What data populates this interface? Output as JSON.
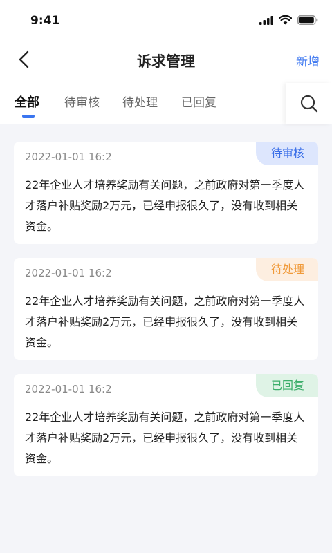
{
  "status_bar": {
    "time": "9:41"
  },
  "nav": {
    "title": "诉求管理",
    "add_label": "新增"
  },
  "tabs": [
    {
      "label": "全部",
      "active": true
    },
    {
      "label": "待审核",
      "active": false
    },
    {
      "label": "待处理",
      "active": false
    },
    {
      "label": "已回复",
      "active": false
    }
  ],
  "colors": {
    "accent": "#3a75f0",
    "pending_review": "#3a6fe8",
    "pending_process": "#f09a3a",
    "replied": "#3cae6a"
  },
  "cards": [
    {
      "time": "2022-01-01 16:2",
      "status": "待审核",
      "content": "22年企业人才培养奖励有关问题，之前政府对第一季度人才落户补贴奖励2万元，已经申报很久了，没有收到相关资金。"
    },
    {
      "time": "2022-01-01 16:2",
      "status": "待处理",
      "content": "22年企业人才培养奖励有关问题，之前政府对第一季度人才落户补贴奖励2万元，已经申报很久了，没有收到相关资金。"
    },
    {
      "time": "2022-01-01 16:2",
      "status": "已回复",
      "content": "22年企业人才培养奖励有关问题，之前政府对第一季度人才落户补贴奖励2万元，已经申报很久了，没有收到相关资金。"
    }
  ],
  "icons": {
    "back": "chevron-left-icon",
    "search": "search-icon",
    "signal": "signal-icon",
    "wifi": "wifi-icon",
    "battery": "battery-icon"
  }
}
